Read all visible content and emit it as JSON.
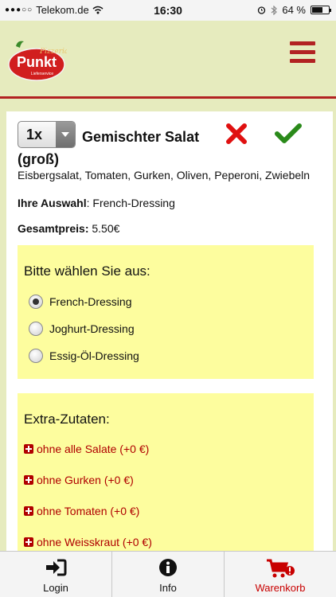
{
  "status_bar": {
    "carrier": "Telekom.de",
    "time": "16:30",
    "battery": "64 %",
    "battery_level": 0.64
  },
  "header": {
    "logo_subtitle": "Pizzeria",
    "logo_title": "Punkt",
    "logo_tagline": "Lieferservice"
  },
  "product": {
    "quantity": "1x",
    "title": "Gemischter Salat (groß)",
    "description": "Eisbergsalat, Tomaten, Gurken, Oliven, Peperoni, Zwiebeln",
    "selection_label": "Ihre Auswahl",
    "selection_value": ": French-Dressing",
    "total_label": "Gesamtpreis:",
    "total_value": " 5.50€"
  },
  "options": {
    "title": "Bitte wählen Sie aus:",
    "items": [
      {
        "label": "French-Dressing",
        "checked": true
      },
      {
        "label": "Joghurt-Dressing",
        "checked": false
      },
      {
        "label": "Essig-Öl-Dressing",
        "checked": false
      }
    ]
  },
  "extras": {
    "title": "Extra-Zutaten:",
    "items": [
      {
        "label": "ohne alle Salate (+0 €)"
      },
      {
        "label": "ohne Gurken (+0 €)"
      },
      {
        "label": "ohne Tomaten (+0 €)"
      },
      {
        "label": "ohne Weisskraut (+0 €)"
      }
    ]
  },
  "tabs": [
    {
      "label": "Login",
      "icon": "login-icon"
    },
    {
      "label": "Info",
      "icon": "info-icon"
    },
    {
      "label": "Warenkorb",
      "icon": "cart-icon",
      "active": true
    }
  ],
  "colors": {
    "accent": "#b22222",
    "background": "#e6ebbe",
    "highlight": "#fdfd9e",
    "confirm": "#2a8a1a"
  }
}
